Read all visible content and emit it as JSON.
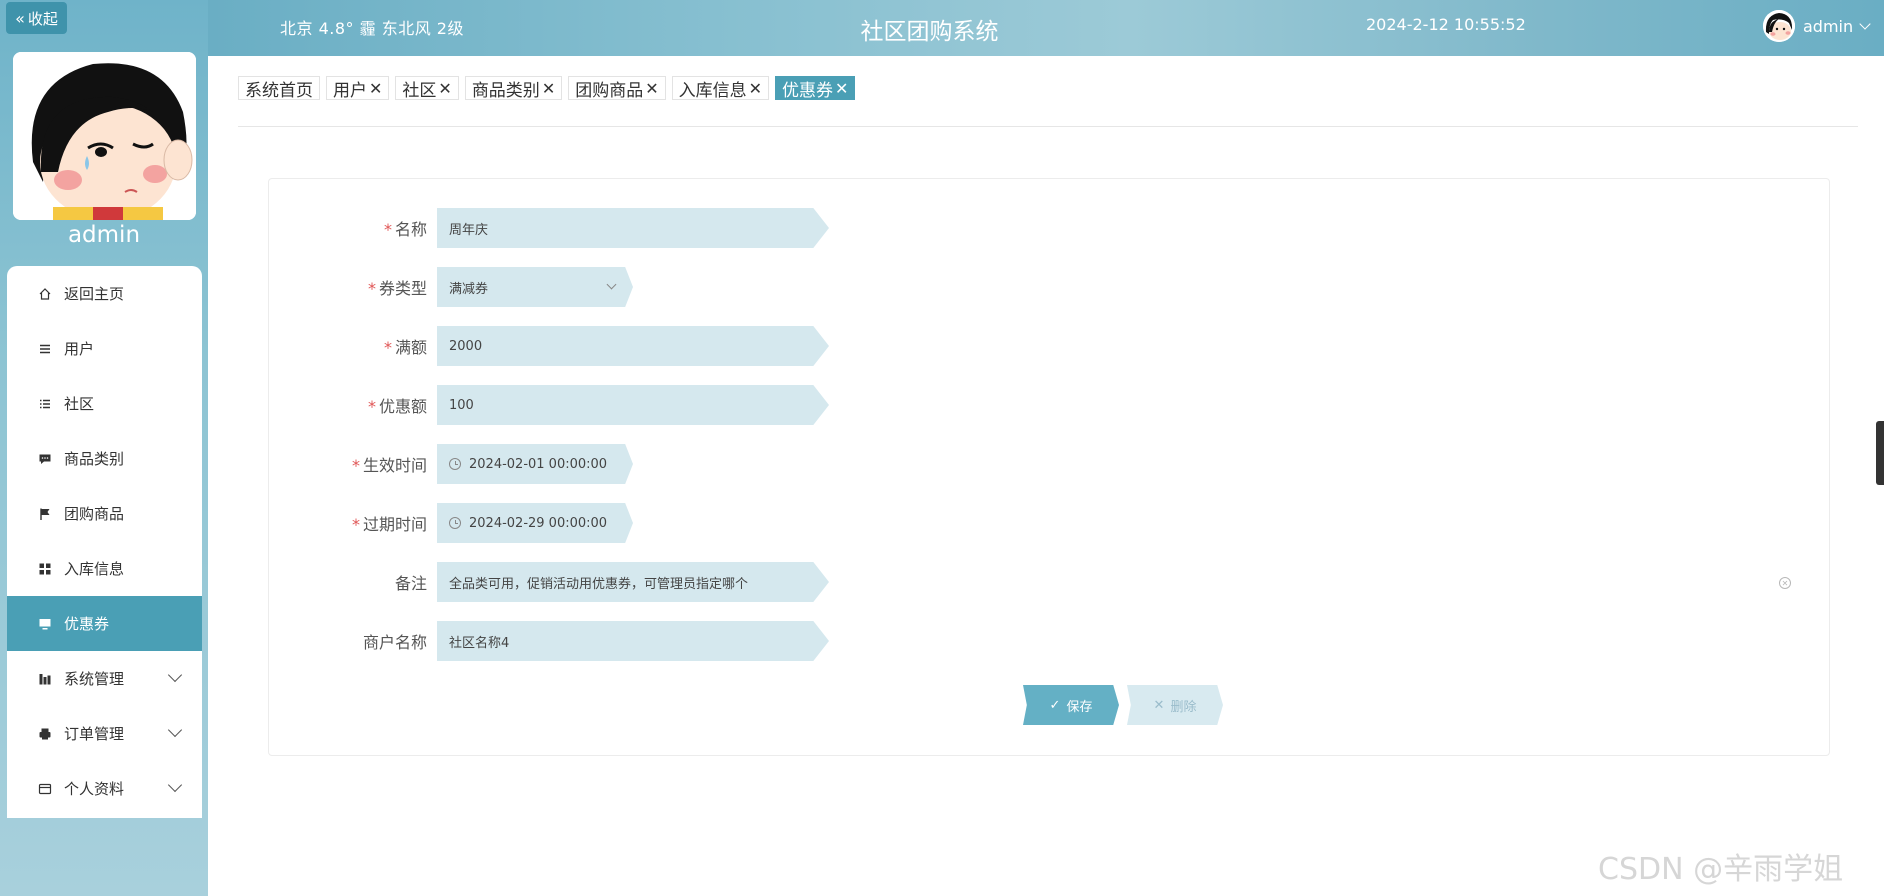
{
  "sidebar": {
    "collapse_label": "收起",
    "username": "admin",
    "menu": [
      {
        "label": "返回主页",
        "icon": "home-icon"
      },
      {
        "label": "用户",
        "icon": "list-icon"
      },
      {
        "label": "社区",
        "icon": "list-indent-icon"
      },
      {
        "label": "商品类别",
        "icon": "chat-icon"
      },
      {
        "label": "团购商品",
        "icon": "flag-icon"
      },
      {
        "label": "入库信息",
        "icon": "grid-icon"
      },
      {
        "label": "优惠券",
        "icon": "monitor-icon",
        "active": true
      },
      {
        "label": "系统管理",
        "icon": "chart-icon",
        "has_submenu": true
      },
      {
        "label": "订单管理",
        "icon": "printer-icon",
        "has_submenu": true
      },
      {
        "label": "个人资料",
        "icon": "wallet-icon",
        "has_submenu": true
      }
    ]
  },
  "header": {
    "weather": "北京  4.8°  霾  东北风  2级",
    "title": "社区团购系统",
    "datetime": "2024-2-12 10:55:52",
    "user": "admin"
  },
  "tabs": [
    {
      "label": "系统首页",
      "closable": false
    },
    {
      "label": "用户",
      "closable": true
    },
    {
      "label": "社区",
      "closable": true
    },
    {
      "label": "商品类别",
      "closable": true
    },
    {
      "label": "团购商品",
      "closable": true
    },
    {
      "label": "入库信息",
      "closable": true
    },
    {
      "label": "优惠券",
      "closable": true,
      "active": true
    }
  ],
  "tab_close_glyph": "✕",
  "form": {
    "name": {
      "label": "名称",
      "value": "周年庆",
      "required": true
    },
    "coupon_type": {
      "label": "券类型",
      "value": "满减券",
      "required": true
    },
    "threshold": {
      "label": "满额",
      "value": "2000",
      "required": true
    },
    "discount": {
      "label": "优惠额",
      "value": "100",
      "required": true
    },
    "start_time": {
      "label": "生效时间",
      "value": "2024-02-01 00:00:00",
      "required": true
    },
    "end_time": {
      "label": "过期时间",
      "value": "2024-02-29 00:00:00",
      "required": true
    },
    "remark": {
      "label": "备注",
      "value": "全品类可用，促销活动用优惠券，可管理员指定哪个",
      "required": false
    },
    "merchant": {
      "label": "商户名称",
      "value": "社区名称4",
      "required": false
    }
  },
  "buttons": {
    "save": "保存",
    "delete": "删除"
  },
  "watermark": "CSDN @辛雨学姐",
  "colors": {
    "primary": "#4a9fb5",
    "field_bg": "#d5e8ee",
    "required": "#e05555"
  }
}
